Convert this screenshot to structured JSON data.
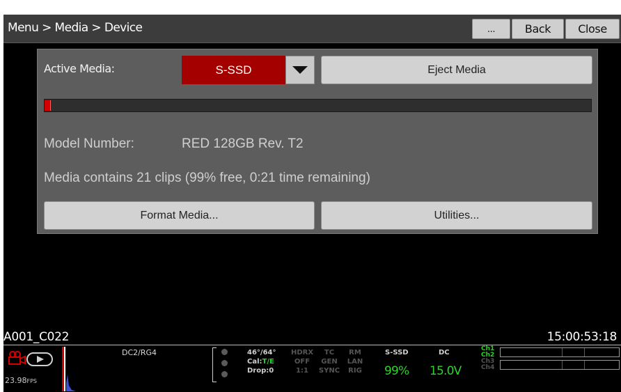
{
  "header": {
    "breadcrumb": "Menu > Media > Device",
    "more_label": "...",
    "back_label": "Back",
    "close_label": "Close"
  },
  "device": {
    "active_media_label": "Active Media:",
    "active_media_value": "S-SSD",
    "eject_label": "Eject Media",
    "usage_fraction": 0.01,
    "model_label": "Model Number:",
    "model_value": "RED 128GB Rev. T2",
    "summary": "Media contains 21 clips (99% free, 0:21 time remaining)",
    "format_label": "Format Media...",
    "utilities_label": "Utilities..."
  },
  "status": {
    "clip_name": "A001_C022",
    "timecode": "15:00:53:18",
    "fps_value": "23.98",
    "fps_unit": "FPS",
    "look": "DC2/RG4",
    "temp": "46°/64°",
    "cal_label": "Cal:",
    "cal_value": "T/E",
    "drop": "Drop:0",
    "hdrx": [
      "HDRX",
      "OFF",
      "1:1"
    ],
    "tc": [
      "TC",
      "GEN",
      "SYNC"
    ],
    "rm": [
      "RM",
      "LAN",
      "RIG"
    ],
    "media_label": "S-SSD",
    "media_value": "99%",
    "power_label": "DC",
    "power_value": "15.0V",
    "channels": [
      {
        "label": "Ch1",
        "active": true
      },
      {
        "label": "Ch2",
        "active": true
      },
      {
        "label": "Ch3",
        "active": false
      },
      {
        "label": "Ch4",
        "active": false
      }
    ]
  },
  "colors": {
    "accent_red": "#a50000",
    "ok_green": "#2fd12f",
    "panel": "#5d5d5d"
  }
}
